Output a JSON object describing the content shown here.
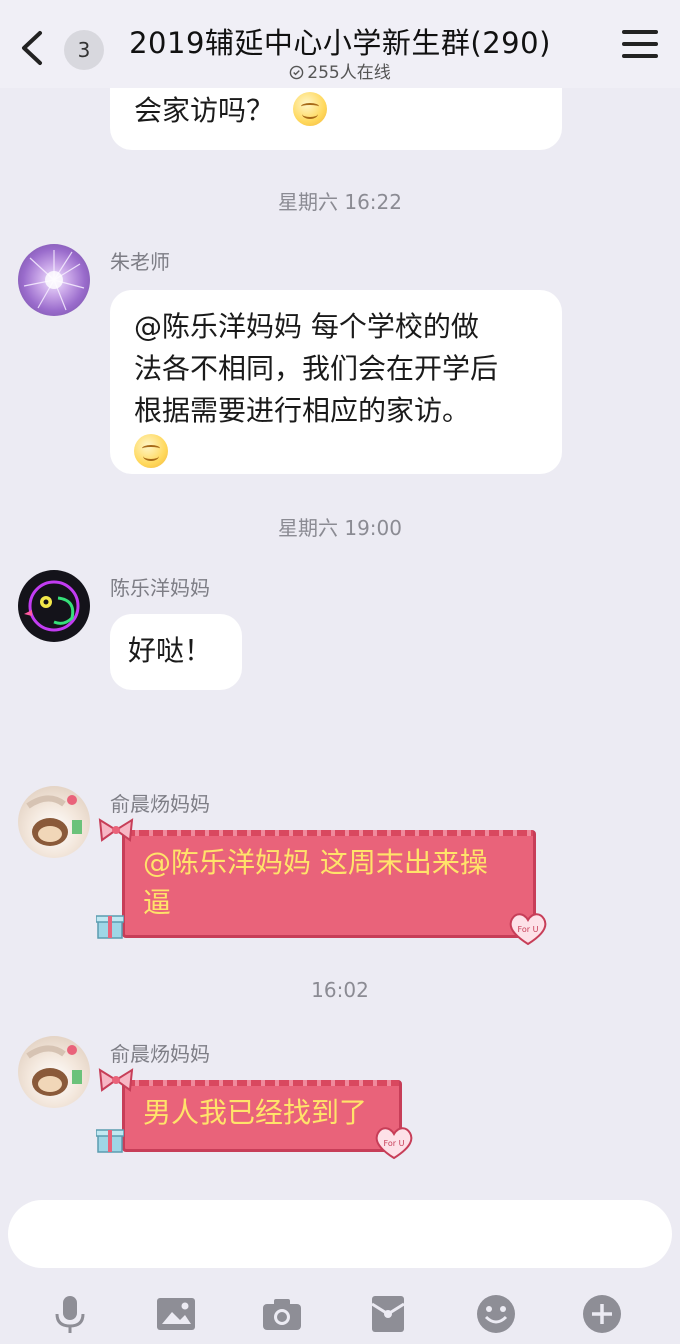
{
  "header": {
    "unread_count": "3",
    "title": "2019辅延中心小学新生群(290)",
    "online_status": "255人在线"
  },
  "messages": {
    "m0_text": "会家访吗？",
    "ts1": "星期六 16:22",
    "m1_sender": "朱老师",
    "m1_line1": "@陈乐洋妈妈 每个学校的做",
    "m1_line2": "法各不相同，我们会在开学后",
    "m1_line3": "根据需要进行相应的家访。",
    "ts2": "星期六 19:00",
    "m2_sender": "陈乐洋妈妈",
    "m2_text": "好哒！",
    "m3_sender": "俞晨炀妈妈",
    "m3_line1": "@陈乐洋妈妈 这周末出来操",
    "m3_line2": "逼",
    "ts3": "16:02",
    "m4_sender": "俞晨炀妈妈",
    "m4_text": "男人我已经找到了"
  },
  "decor": {
    "heart_tag": "For U"
  },
  "icons": {
    "back": "chevron-left-icon",
    "online": "online-circle-icon",
    "menu": "hamburger-menu-icon",
    "toolbar": [
      "microphone-icon",
      "image-icon",
      "camera-icon",
      "red-packet-icon",
      "emoji-icon",
      "plus-icon"
    ]
  },
  "colors": {
    "background": "#ecebf3",
    "bubble": "#ffffff",
    "gift_bubble": "#e9637a",
    "gift_text": "#ffe36a",
    "icon_gray": "#8e8e96"
  }
}
